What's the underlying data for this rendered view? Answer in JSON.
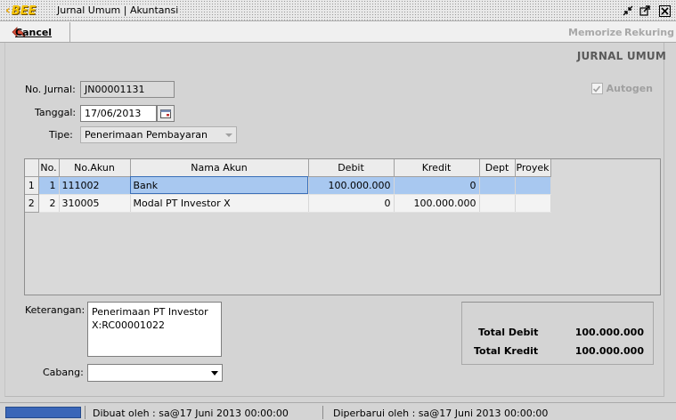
{
  "window": {
    "logo_text": "BEE",
    "title": "Jurnal Umum | Akuntansi"
  },
  "toolbar": {
    "cancel_label": "Cancel",
    "memorize_label": "Memorize",
    "rekuring_label": "Rekuring"
  },
  "form": {
    "title": "JURNAL UMUM",
    "no_jurnal_label": "No. Jurnal:",
    "no_jurnal_value": "JN00001131",
    "tanggal_label": "Tanggal:",
    "tanggal_value": "17/06/2013",
    "tipe_label": "Tipe:",
    "tipe_value": "Penerimaan Pembayaran",
    "autogen_label": "Autogen",
    "autogen_checked": true
  },
  "grid": {
    "columns": [
      "No.",
      "No.Akun",
      "Nama Akun",
      "Debit",
      "Kredit",
      "Dept",
      "Proyek"
    ],
    "rows": [
      {
        "row_header": "1",
        "no": "1",
        "no_akun": "111002",
        "nama_akun": "Bank",
        "debit": "100.000.000",
        "kredit": "0",
        "dept": "",
        "proyek": ""
      },
      {
        "row_header": "2",
        "no": "2",
        "no_akun": "310005",
        "nama_akun": "Modal PT Investor X",
        "debit": "0",
        "kredit": "100.000.000",
        "dept": "",
        "proyek": ""
      }
    ]
  },
  "keterangan": {
    "label": "Keterangan:",
    "line1": "Penerimaan PT Investor",
    "line2": "X:RC00001022"
  },
  "cabang": {
    "label": "Cabang:",
    "value": ""
  },
  "totals": {
    "debit_label": "Total Debit",
    "debit_value": "100.000.000",
    "kredit_label": "Total Kredit",
    "kredit_value": "100.000.000"
  },
  "status": {
    "created": "Dibuat oleh : sa@17 Juni 2013  00:00:00",
    "updated": "Diperbarui oleh : sa@17 Juni 2013  00:00:00"
  },
  "colors": {
    "selection": "#a8c8f0",
    "status_blue": "#3a66b8",
    "logo_yellow": "#f4c200"
  }
}
